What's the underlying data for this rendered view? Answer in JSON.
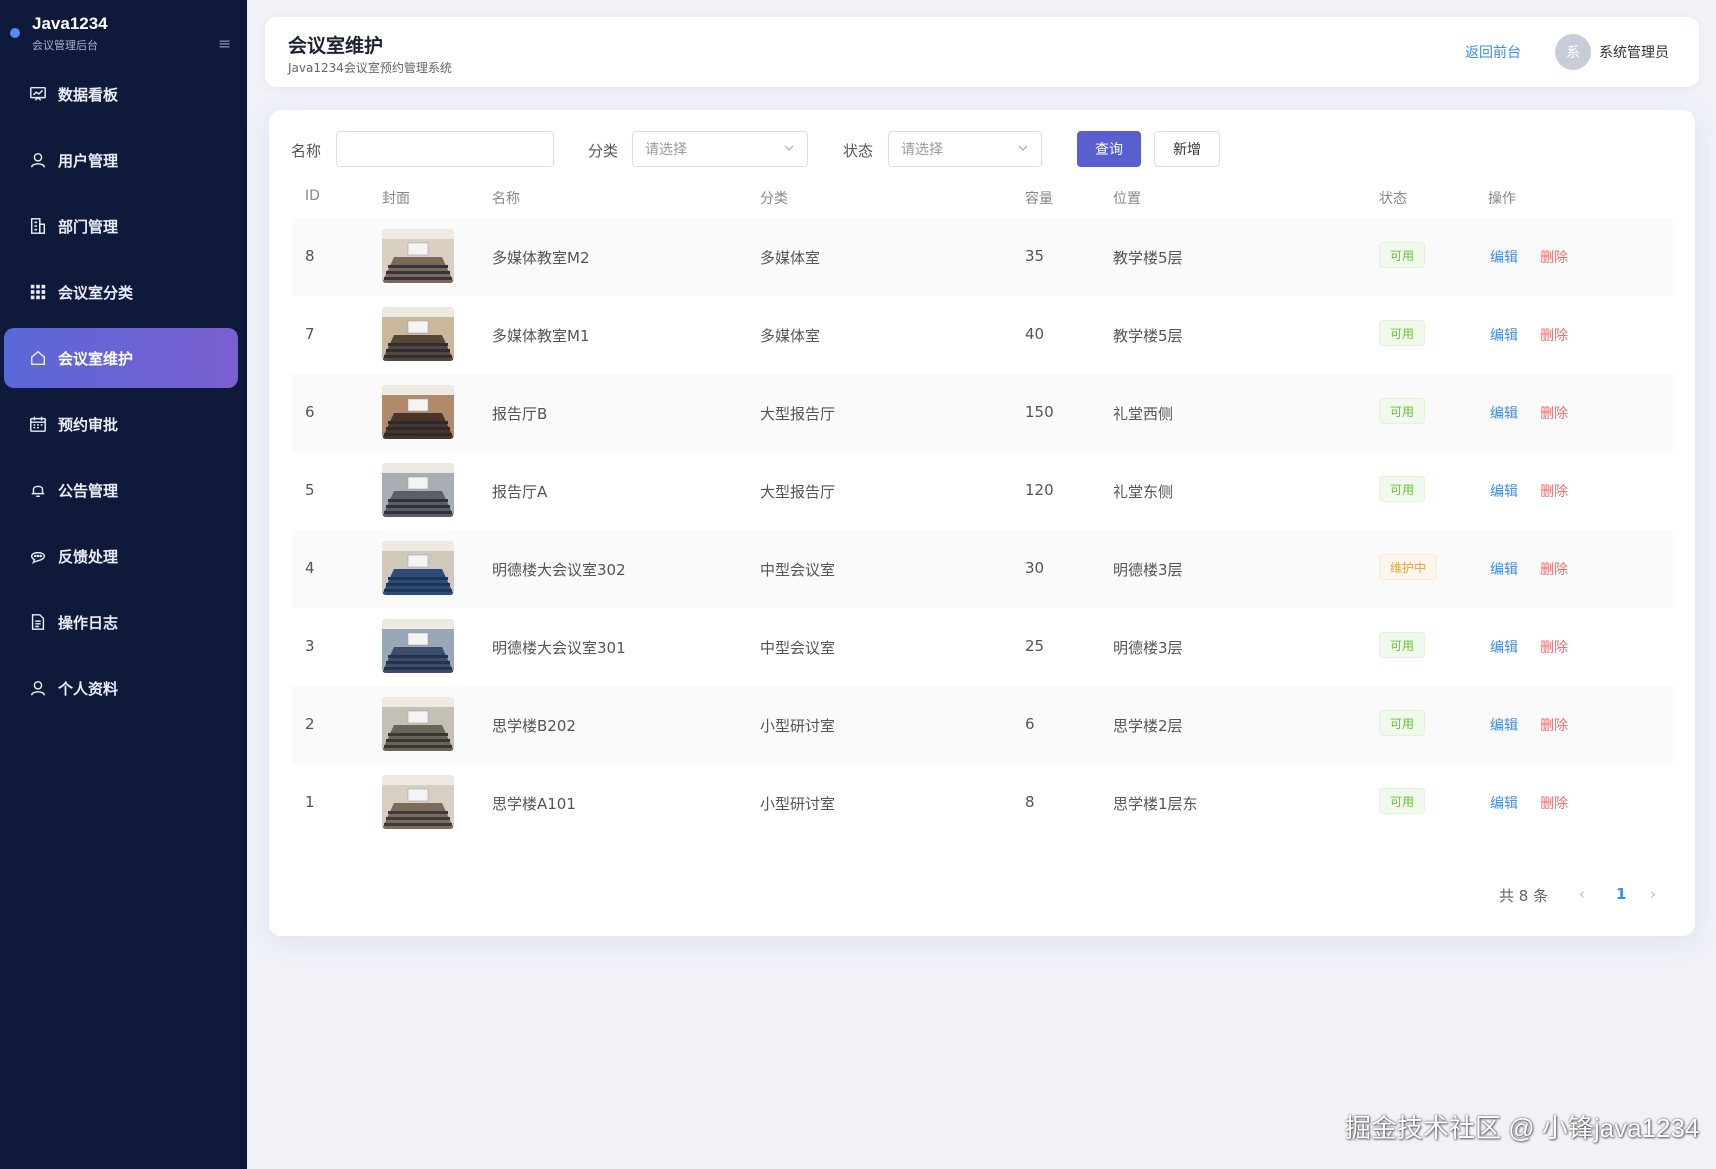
{
  "brand": {
    "title": "Java1234",
    "subtitle": "会议管理后台"
  },
  "sidebar": {
    "items": [
      {
        "label": "数据看板",
        "icon": "dashboard-icon"
      },
      {
        "label": "用户管理",
        "icon": "user-icon"
      },
      {
        "label": "部门管理",
        "icon": "building-icon"
      },
      {
        "label": "会议室分类",
        "icon": "grid-icon"
      },
      {
        "label": "会议室维护",
        "icon": "home-icon",
        "active": true
      },
      {
        "label": "预约审批",
        "icon": "calendar-icon"
      },
      {
        "label": "公告管理",
        "icon": "bell-icon"
      },
      {
        "label": "反馈处理",
        "icon": "chat-icon"
      },
      {
        "label": "操作日志",
        "icon": "document-icon"
      },
      {
        "label": "个人资料",
        "icon": "profile-icon"
      }
    ]
  },
  "header": {
    "title": "会议室维护",
    "subtitle": "Java1234会议室预约管理系统",
    "back_link": "返回前台",
    "avatar_char": "系",
    "user_name": "系统管理员"
  },
  "filters": {
    "name_label": "名称",
    "name_value": "",
    "category_label": "分类",
    "category_placeholder": "请选择",
    "status_label": "状态",
    "status_placeholder": "请选择",
    "query_button": "查询",
    "add_button": "新增"
  },
  "table": {
    "headers": {
      "id": "ID",
      "cover": "封面",
      "name": "名称",
      "category": "分类",
      "capacity": "容量",
      "location": "位置",
      "status": "状态",
      "ops": "操作"
    },
    "edit_label": "编辑",
    "delete_label": "删除",
    "rows": [
      {
        "id": "8",
        "name": "多媒体教室M2",
        "category": "多媒体室",
        "capacity": "35",
        "location": "教学楼5层",
        "status": "可用",
        "status_type": "ok"
      },
      {
        "id": "7",
        "name": "多媒体教室M1",
        "category": "多媒体室",
        "capacity": "40",
        "location": "教学楼5层",
        "status": "可用",
        "status_type": "ok"
      },
      {
        "id": "6",
        "name": "报告厅B",
        "category": "大型报告厅",
        "capacity": "150",
        "location": "礼堂西侧",
        "status": "可用",
        "status_type": "ok"
      },
      {
        "id": "5",
        "name": "报告厅A",
        "category": "大型报告厅",
        "capacity": "120",
        "location": "礼堂东侧",
        "status": "可用",
        "status_type": "ok"
      },
      {
        "id": "4",
        "name": "明德楼大会议室302",
        "category": "中型会议室",
        "capacity": "30",
        "location": "明德楼3层",
        "status": "维护中",
        "status_type": "warn"
      },
      {
        "id": "3",
        "name": "明德楼大会议室301",
        "category": "中型会议室",
        "capacity": "25",
        "location": "明德楼3层",
        "status": "可用",
        "status_type": "ok"
      },
      {
        "id": "2",
        "name": "思学楼B202",
        "category": "小型研讨室",
        "capacity": "6",
        "location": "思学楼2层",
        "status": "可用",
        "status_type": "ok"
      },
      {
        "id": "1",
        "name": "思学楼A101",
        "category": "小型研讨室",
        "capacity": "8",
        "location": "思学楼1层东",
        "status": "可用",
        "status_type": "ok"
      }
    ]
  },
  "pagination": {
    "total_text": "共 8 条",
    "current_page": "1",
    "prev": "‹",
    "next": "›"
  },
  "watermark": "掘金技术社区 @ 小锋java1234"
}
